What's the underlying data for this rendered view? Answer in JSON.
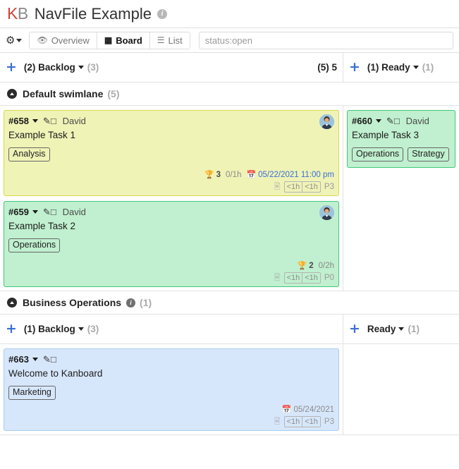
{
  "header": {
    "logo_k": "K",
    "logo_b": "B",
    "title": "NavFile Example",
    "info_icon": "info-icon"
  },
  "toolbar": {
    "gear_icon": "gear-icon",
    "views": [
      {
        "label": "Overview",
        "icon": "eye-icon",
        "active": false
      },
      {
        "label": "Board",
        "icon": "grid-icon",
        "active": true
      },
      {
        "label": "List",
        "icon": "list-icon",
        "active": false
      }
    ],
    "search_value": "status:open",
    "search_placeholder": "status:open"
  },
  "board": {
    "swimlanes": [
      {
        "name": "Default swimlane",
        "count": "(5)",
        "has_info": false,
        "columns": [
          {
            "plus": "+",
            "title": "(2) Backlog",
            "limit": "(3)",
            "score": "(5) 5"
          },
          {
            "plus": "+",
            "title": "(1) Ready",
            "limit": "(1)",
            "score": ""
          }
        ]
      },
      {
        "name": "Business Operations",
        "count": "(1)",
        "has_info": true,
        "info_icon": "info-icon",
        "columns": [
          {
            "plus": "+",
            "title": "(1) Backlog",
            "limit": "(3)",
            "score": ""
          },
          {
            "plus": "+",
            "title": "Ready",
            "limit": "(1)",
            "score": ""
          }
        ]
      }
    ],
    "tasks": {
      "t658": {
        "id": "#658",
        "color": "yellow",
        "assignee": "David",
        "title": "Example Task 1",
        "tags": [
          "Analysis"
        ],
        "score": "3",
        "time": "0/1h",
        "date": "05/22/2021 11:00 pm",
        "hours": [
          "<1h",
          "<1h"
        ],
        "priority": "P3",
        "has_avatar": true,
        "has_description": true
      },
      "t659": {
        "id": "#659",
        "color": "green",
        "assignee": "David",
        "title": "Example Task 2",
        "tags": [
          "Operations"
        ],
        "score": "2",
        "time": "0/2h",
        "date": "",
        "hours": [
          "<1h",
          "<1h"
        ],
        "priority": "P0",
        "has_avatar": true,
        "has_description": true
      },
      "t660": {
        "id": "#660",
        "color": "green",
        "assignee": "David",
        "title": "Example Task 3",
        "tags": [
          "Operations",
          "Strategy"
        ],
        "score": "",
        "time": "",
        "date": "",
        "hours": [],
        "priority": "",
        "has_avatar": false,
        "has_description": false
      },
      "t663": {
        "id": "#663",
        "color": "blue",
        "assignee": "",
        "title": "Welcome to Kanboard",
        "tags": [
          "Marketing"
        ],
        "score": "",
        "time": "",
        "date": "05/24/2021",
        "hours": [
          "<1h",
          "<1h"
        ],
        "priority": "P3",
        "has_avatar": false,
        "has_description": true
      }
    }
  },
  "icons": {
    "plus": "plus-icon",
    "caret_down": "chevron-down-icon",
    "edit": "edit-icon",
    "trophy": "trophy-icon",
    "calendar": "calendar-icon",
    "document": "document-icon",
    "avatar": "avatar"
  },
  "colors": {
    "accent_blue": "#3b6fd4",
    "card_yellow": "#eff3b6",
    "card_green": "#c0f0cf",
    "card_blue": "#d7e7fb",
    "logo_red": "#d04437"
  }
}
